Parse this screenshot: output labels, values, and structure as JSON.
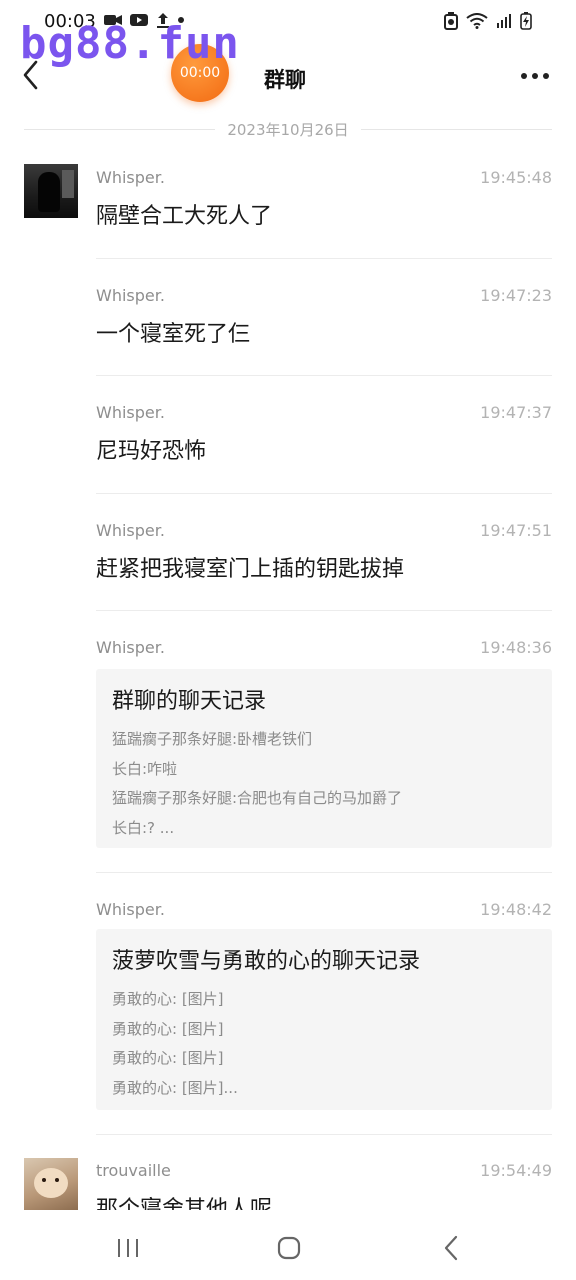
{
  "status_bar": {
    "time": "00:03"
  },
  "watermark": "bg88.fun",
  "header": {
    "title": "群聊",
    "call_timer": "00:00"
  },
  "date_divider": "2023年10月26日",
  "messages": [
    {
      "sender": "Whisper.",
      "time": "19:45:48",
      "text": "隔壁合工大死人了"
    },
    {
      "sender": "Whisper.",
      "time": "19:47:23",
      "text": "一个寝室死了仨"
    },
    {
      "sender": "Whisper.",
      "time": "19:47:37",
      "text": "尼玛好恐怖"
    },
    {
      "sender": "Whisper.",
      "time": "19:47:51",
      "text": "赶紧把我寝室门上插的钥匙拔掉"
    },
    {
      "sender": "Whisper.",
      "time": "19:48:36",
      "card": {
        "title": "群聊的聊天记录",
        "lines": [
          "猛踹瘸子那条好腿:卧槽老铁们",
          "长白:咋啦",
          "猛踹瘸子那条好腿:合肥也有自己的马加爵了",
          "长白:? ..."
        ]
      }
    },
    {
      "sender": "Whisper.",
      "time": "19:48:42",
      "card": {
        "title": "菠萝吹雪与勇敢的心的聊天记录",
        "lines": [
          "勇敢的心: [图片]",
          "勇敢的心: [图片]",
          "勇敢的心: [图片]",
          "勇敢的心: [图片]..."
        ]
      }
    },
    {
      "sender": "trouvaille",
      "time": "19:54:49",
      "text": "那个寝舍其他人呢"
    }
  ]
}
